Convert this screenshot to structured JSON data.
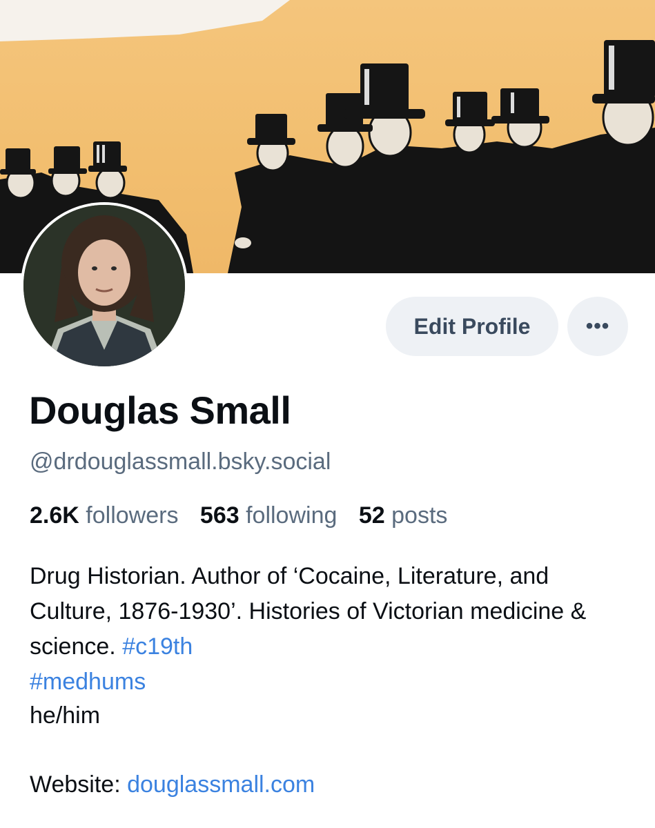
{
  "profile": {
    "display_name": "Douglas Small",
    "handle": "@drdouglassmall.bsky.social",
    "stats": {
      "followers_count": "2.6K",
      "followers_label": "followers",
      "following_count": "563",
      "following_label": "following",
      "posts_count": "52",
      "posts_label": "posts"
    },
    "bio": {
      "text": "Drug Historian. Author of ‘Cocaine, Literature, and Culture, 1876-1930’. Histories of Victorian medicine & science.",
      "hashtags": [
        "#c19th",
        "#medhums"
      ],
      "pronouns": "he/him"
    },
    "website": {
      "label": "Website:",
      "url": "douglassmall.com"
    }
  },
  "actions": {
    "edit_label": "Edit Profile",
    "more_label": "•••"
  },
  "colors": {
    "accent_link": "#3b82e0",
    "banner_background": "#f2be6f",
    "button_background": "#eef1f5",
    "muted_text": "#5a6b7e"
  },
  "icons": {
    "more": "more-horizontal-icon"
  }
}
